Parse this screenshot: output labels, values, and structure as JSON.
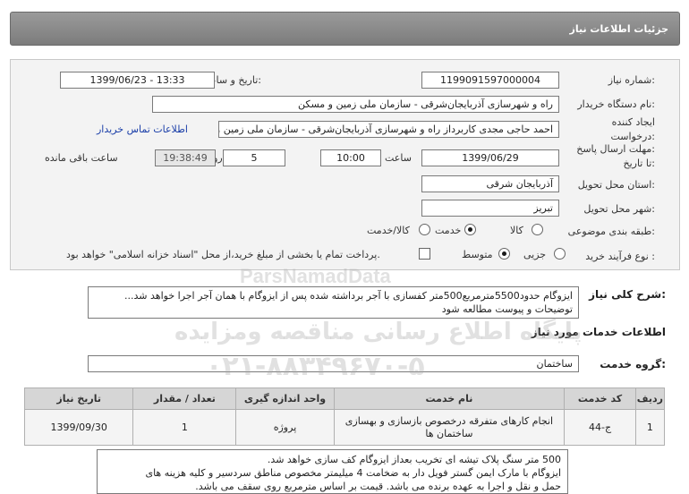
{
  "header": {
    "title": "جزئیات اطلاعات نیاز"
  },
  "form": {
    "need_number_label": "شماره نیاز:",
    "need_number_value": "1199091597000004",
    "announce_label": "تاریخ و ساعت اعلان عمومی:",
    "announce_value": "1399/06/23 - 13:33",
    "buyer_org_label": "نام دستگاه خریدار:",
    "buyer_org_value": "راه و شهرسازی آذربایجان‌شرقی - سازمان ملی زمین و مسکن",
    "creator_label_1": "ایجاد کننده",
    "creator_label_2": "درخواست:",
    "creator_value": "احمد حاجی مجدی کاربرداز راه و شهرسازی آذربایجان‌شرقی - سازمان ملی زمین و مسکن",
    "contact_link": "اطلاعات تماس خریدار",
    "deadline_label_1": "مهلت ارسال پاسخ:",
    "deadline_label_2": "تا تاریخ:",
    "deadline_date": "1399/06/29",
    "time_label": "ساعت",
    "time_value": "10:00",
    "days_value": "5",
    "days_label": "روز و",
    "remaining_value": "19:38:49",
    "remaining_label": "ساعت باقی مانده",
    "province_label": "استان محل تحویل:",
    "province_value": "آذربایجان شرقی",
    "city_label": "شهر محل تحویل:",
    "city_value": "تبریز",
    "category_label": "طبقه بندی موضوعی:",
    "category_options": [
      "کالا",
      "خدمت",
      "کالا/خدمت"
    ],
    "category_selected": "خدمت",
    "process_label": "نوع فرآیند خرید :",
    "process_options": [
      "جزیی",
      "متوسط"
    ],
    "process_selected": "متوسط",
    "payment_text": "پرداخت تمام یا بخشی از مبلغ خرید،از محل \"اسناد خزانه اسلامی\" خواهد بود."
  },
  "description": {
    "label": "شرح کلی نیاز:",
    "line1": "ایزوگام حدود5500مترمربع500متر کفسازی با آجر برداشته شده پس از ایزوگام با همان آجر اجرا خواهد شد...",
    "line2": "توضیحات و پیوست مطالعه شود"
  },
  "services": {
    "section_title": "اطلاعات خدمات مورد نیاز",
    "group_label": "گروه خدمت:",
    "group_value": "ساختمان",
    "columns": [
      "ردیف",
      "کد خدمت",
      "نام خدمت",
      "واحد اندازه گیری",
      "تعداد / مقدار",
      "تاریخ نیاز"
    ],
    "rows": [
      {
        "row": "1",
        "code": "ج-44",
        "name": "انجام کارهای متفرقه درخصوص بازسازی و بهسازی ساختمان ها",
        "unit": "پروژه",
        "qty": "1",
        "date": "1399/09/30"
      }
    ]
  },
  "notes": {
    "line1": "500 متر سنگ پلاک تیشه ای تخریب بعداز ایزوگام کف سازی خواهد شد.",
    "line2": "ایزوگام با مارک ایمن گستر فویل دار به ضخامت 4 میلیمتر مخصوص مناطق سردسیر و کلیه هزینه های",
    "line3": "حمل و نقل و اجرا به عهده برنده می باشد. قیمت بر اساس مترمربع روی سقف می باشد."
  },
  "watermark": {
    "brand": "ParsNamadData",
    "line1": "پایگاه اطلاع رسانی مناقصه ومزایده",
    "phone": "۰۲۱-۸۸۳۴۹۶۷۰-۵"
  }
}
